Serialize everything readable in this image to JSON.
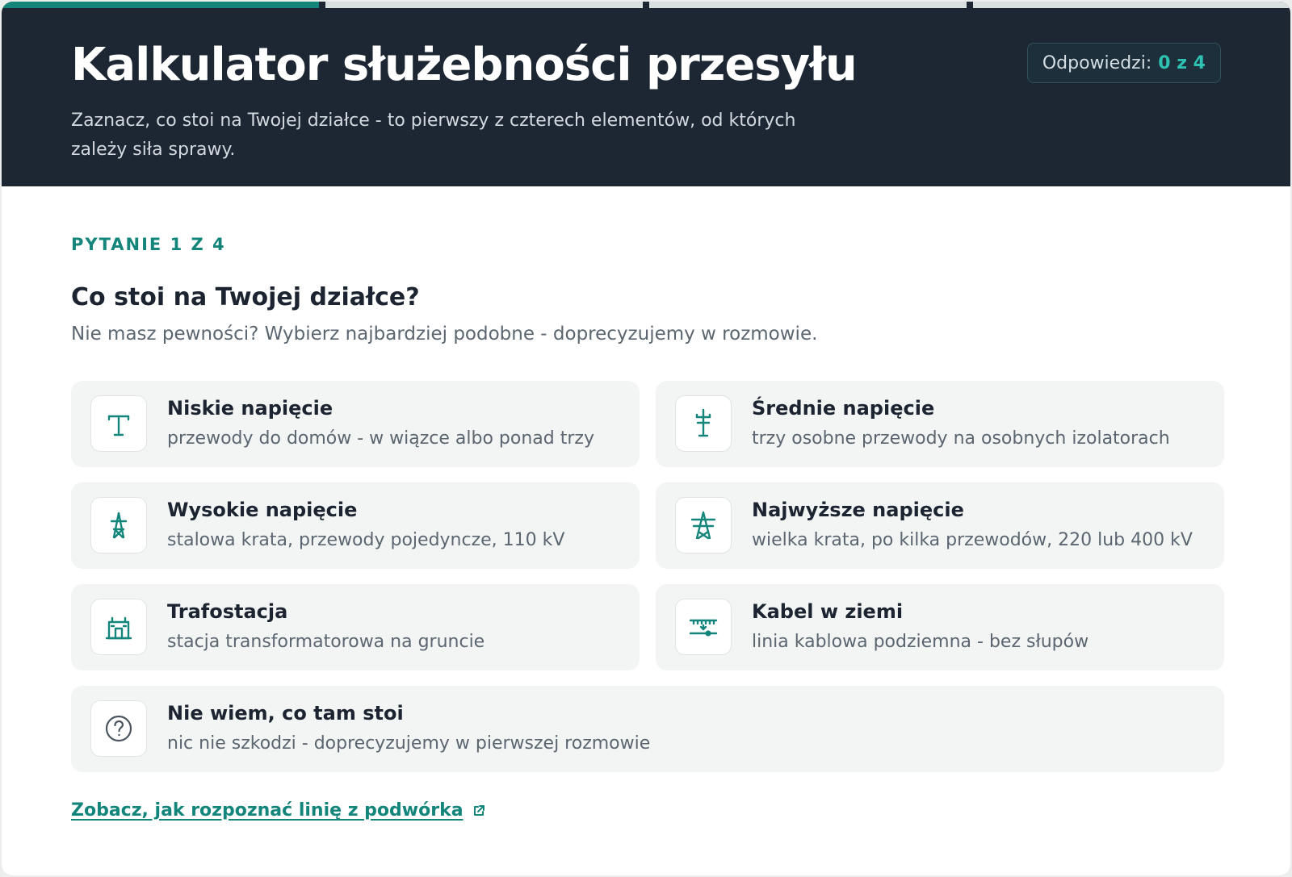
{
  "progress": {
    "total_steps": 4,
    "current_step": 1
  },
  "header": {
    "title": "Kalkulator służebności przesyłu",
    "subtitle": "Zaznacz, co stoi na Twojej działce - to pierwszy z czterech elementów, od których zależy siła sprawy.",
    "counter_label": "Odpowiedzi:",
    "counter_value": "0 z 4"
  },
  "question": {
    "step_label": "PYTANIE 1 Z 4",
    "title": "Co stoi na Twojej działce?",
    "hint": "Nie masz pewności? Wybierz najbardziej podobne - doprecyzujemy w rozmowie."
  },
  "options": [
    {
      "icon": "low-voltage-pole-icon",
      "title": "Niskie napięcie",
      "desc": "przewody do domów - w wiązce albo ponad trzy"
    },
    {
      "icon": "medium-voltage-pole-icon",
      "title": "Średnie napięcie",
      "desc": "trzy osobne przewody na osobnych izolatorach"
    },
    {
      "icon": "high-voltage-pylon-icon",
      "title": "Wysokie napięcie",
      "desc": "stalowa krata, przewody pojedyncze, 110 kV"
    },
    {
      "icon": "highest-voltage-pylon-icon",
      "title": "Najwyższe napięcie",
      "desc": "wielka krata, po kilka przewodów, 220 lub 400 kV"
    },
    {
      "icon": "transformer-station-icon",
      "title": "Trafostacja",
      "desc": "stacja transformatorowa na gruncie"
    },
    {
      "icon": "underground-cable-icon",
      "title": "Kabel w ziemi",
      "desc": "linia kablowa podziemna - bez słupów"
    },
    {
      "icon": "question-icon",
      "title": "Nie wiem, co tam stoi",
      "desc": "nic nie szkodzi - doprecyzujemy w pierwszej rozmowie"
    }
  ],
  "link": {
    "label": "Zobacz, jak rozpoznać linię z podwórka",
    "icon": "external-link-icon"
  },
  "colors": {
    "accent": "#13857b",
    "header_bg": "#1c2733",
    "counter_value": "#2fc2b2",
    "option_bg": "#f3f5f5"
  }
}
